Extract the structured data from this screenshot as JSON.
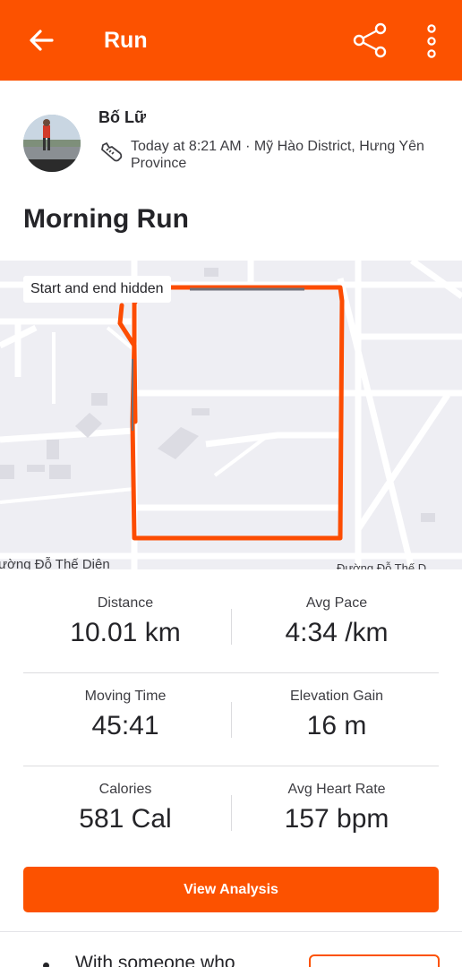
{
  "colors": {
    "accent": "#fc5200",
    "text": "#242428",
    "map_bg": "#eeeef3",
    "route": "#fc4c02"
  },
  "header": {
    "title": "Run",
    "back_icon": "arrow-left-icon",
    "share_icon": "share-icon",
    "more_icon": "more-vertical-icon"
  },
  "athlete": {
    "name": "Bố Lữ",
    "activity_icon": "shoe-icon",
    "meta": "Today at 8:21 AM · Mỹ Hào District, Hưng Yên Province"
  },
  "activity": {
    "title": "Morning Run"
  },
  "map": {
    "badge": "Start and end hidden",
    "street_left": "ường Đỗ Thế Diên",
    "street_right": "Đường Đỗ Thế D"
  },
  "stats": [
    {
      "left": {
        "label": "Distance",
        "value": "10.01 km"
      },
      "right": {
        "label": "Avg Pace",
        "value": "4:34 /km"
      }
    },
    {
      "left": {
        "label": "Moving Time",
        "value": "45:41"
      },
      "right": {
        "label": "Elevation Gain",
        "value": "16 m"
      }
    },
    {
      "left": {
        "label": "Calories",
        "value": "581 Cal"
      },
      "right": {
        "label": "Avg Heart Rate",
        "value": "157 bpm"
      }
    }
  ],
  "actions": {
    "view_analysis": "View Analysis"
  },
  "suggestion": {
    "text": "With someone who"
  }
}
